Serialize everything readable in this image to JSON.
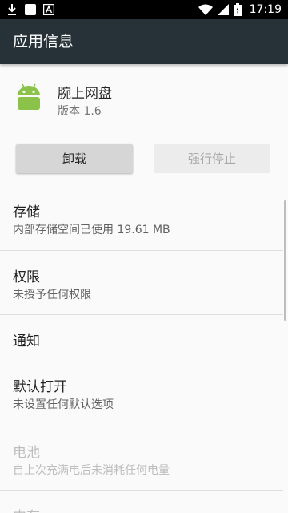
{
  "status_bar": {
    "time": "17:19",
    "icons": [
      "download-icon",
      "square-app-icon",
      "a-app-icon",
      "wifi-icon",
      "signal-icon",
      "battery-icon"
    ]
  },
  "app_bar": {
    "title": "应用信息"
  },
  "app": {
    "name": "腕上网盘",
    "version": "版本 1.6",
    "icon": "android-icon"
  },
  "buttons": {
    "uninstall": "卸载",
    "force_stop": "强行停止"
  },
  "prefs": {
    "storage": {
      "title": "存储",
      "summary": "内部存储空间已使用 19.61 MB"
    },
    "permissions": {
      "title": "权限",
      "summary": "未授予任何权限"
    },
    "notifications": {
      "title": "通知"
    },
    "open_by_default": {
      "title": "默认打开",
      "summary": "未设置任何默认选项"
    },
    "battery": {
      "title": "电池",
      "summary": "自上次充满电后未消耗任何电量"
    },
    "memory": {
      "title": "内存"
    }
  },
  "colors": {
    "app_bar": "#263238",
    "android_green": "#8bc34a",
    "disabled_text": "#bdbdbd"
  }
}
